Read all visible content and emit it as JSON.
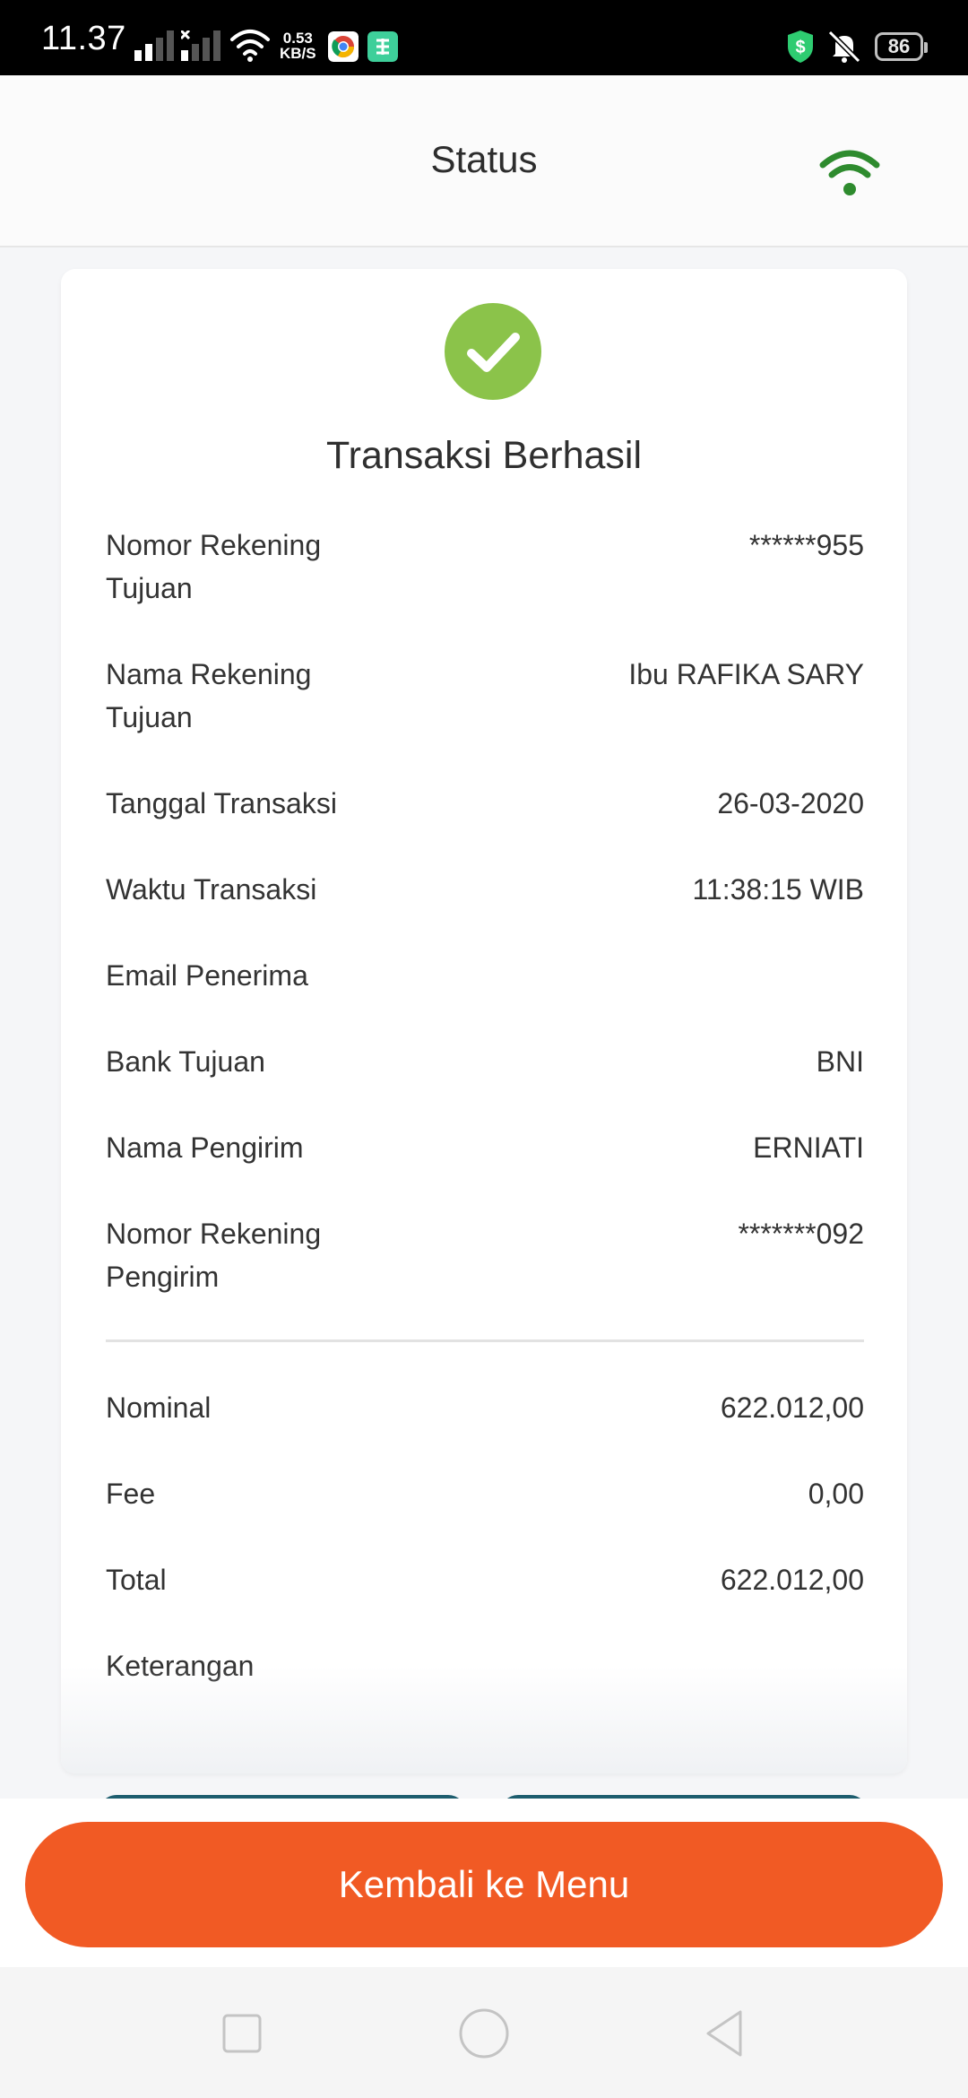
{
  "status_bar": {
    "time": "11.37",
    "net_speed_value": "0.53",
    "net_speed_unit": "KB/S",
    "battery_level": "86"
  },
  "header": {
    "title": "Status"
  },
  "receipt": {
    "status_title": "Transaksi Berhasil",
    "rows": [
      {
        "label": "Nomor Rekening Tujuan",
        "value": "******955"
      },
      {
        "label": "Nama Rekening Tujuan",
        "value": "Ibu RAFIKA SARY"
      },
      {
        "label": "Tanggal Transaksi",
        "value": "26-03-2020"
      },
      {
        "label": "Waktu Transaksi",
        "value": "11:38:15 WIB"
      },
      {
        "label": "Email Penerima",
        "value": ""
      },
      {
        "label": "Bank Tujuan",
        "value": "BNI"
      },
      {
        "label": "Nama Pengirim",
        "value": "ERNIATI"
      },
      {
        "label": "Nomor Rekening Pengirim",
        "value": "*******092"
      }
    ],
    "amounts": [
      {
        "label": "Nominal",
        "value": "622.012,00"
      },
      {
        "label": "Fee",
        "value": "0,00"
      },
      {
        "label": "Total",
        "value": "622.012,00"
      },
      {
        "label": "Keterangan",
        "value": ""
      }
    ]
  },
  "footer": {
    "back_button_label": "Kembali ke Menu"
  },
  "colors": {
    "accent_orange": "#f15a24",
    "success_green": "#8bc34a",
    "connection_green": "#2e8b2e",
    "hidden_button_teal": "#1d5d6e"
  },
  "icons": {
    "connection": "wifi-icon",
    "success": "check-circle-icon",
    "nav": [
      "recent-apps-icon",
      "home-icon",
      "back-icon"
    ]
  }
}
